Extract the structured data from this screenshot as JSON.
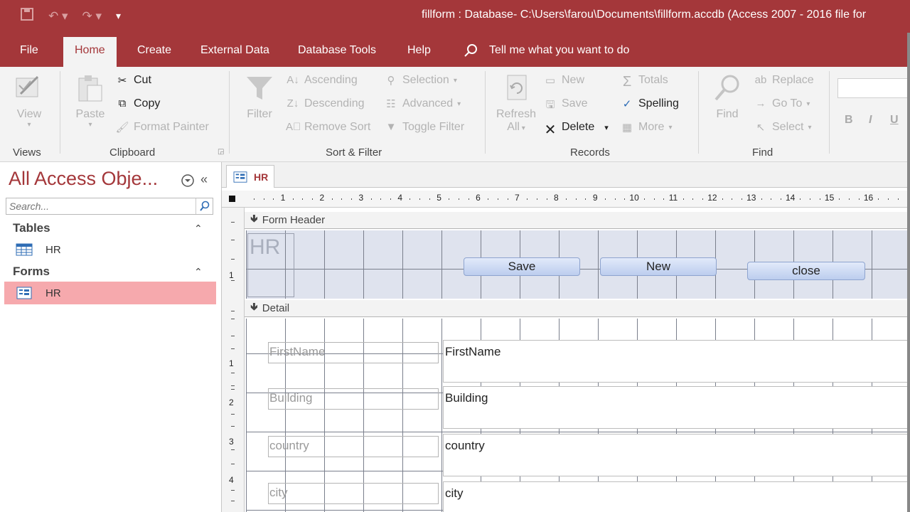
{
  "window": {
    "title": "fillform : Database- C:\\Users\\farou\\Documents\\fillform.accdb (Access 2007 - 2016 file for"
  },
  "tabs": [
    "File",
    "Home",
    "Create",
    "External Data",
    "Database Tools",
    "Help"
  ],
  "tell_me": "Tell me what you want to do",
  "ribbon": {
    "views": {
      "view": "View",
      "group": "Views"
    },
    "clipboard": {
      "paste": "Paste",
      "cut": "Cut",
      "copy": "Copy",
      "format_painter": "Format Painter",
      "group": "Clipboard"
    },
    "sort_filter": {
      "filter": "Filter",
      "ascending": "Ascending",
      "descending": "Descending",
      "remove_sort": "Remove Sort",
      "selection": "Selection",
      "advanced": "Advanced",
      "toggle_filter": "Toggle Filter",
      "group": "Sort & Filter"
    },
    "records": {
      "refresh": "Refresh",
      "refresh_all": "All",
      "new": "New",
      "save": "Save",
      "delete": "Delete",
      "totals": "Totals",
      "spelling": "Spelling",
      "more": "More",
      "group": "Records"
    },
    "find": {
      "find": "Find",
      "replace": "Replace",
      "goto": "Go To",
      "select": "Select",
      "group": "Find"
    },
    "text_format": {
      "bold": "B",
      "italic": "I",
      "underline": "U"
    }
  },
  "nav": {
    "title": "All Access Obje...",
    "search_placeholder": "Search...",
    "categories": [
      {
        "name": "Tables",
        "items": [
          "HR"
        ]
      },
      {
        "name": "Forms",
        "items": [
          "HR"
        ]
      }
    ]
  },
  "document_tab": "HR",
  "ruler_numbers": [
    "1",
    "2",
    "3",
    "4",
    "5",
    "6",
    "7",
    "8",
    "9",
    "10",
    "11",
    "12",
    "13",
    "14",
    "15",
    "16"
  ],
  "vruler_numbers": [
    "1",
    "1",
    "2",
    "3",
    "4"
  ],
  "form": {
    "header_section": "Form Header",
    "detail_section": "Detail",
    "header_label": "HR",
    "buttons": [
      "Save",
      "New",
      "close"
    ],
    "fields": [
      {
        "label": "FirstName",
        "control": "FirstName"
      },
      {
        "label": "Building",
        "control": "Building"
      },
      {
        "label": "country",
        "control": "country"
      },
      {
        "label": "city",
        "control": "city"
      }
    ]
  }
}
